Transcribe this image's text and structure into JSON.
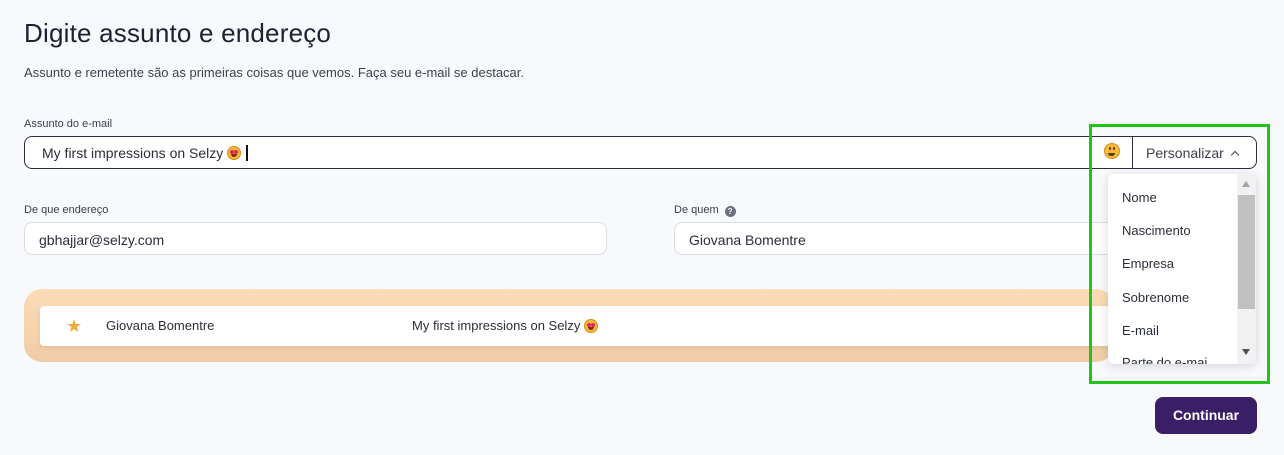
{
  "page": {
    "title": "Digite assunto e endereço",
    "subtitle": "Assunto e remetente são as primeiras coisas que vemos. Faça seu e-mail se destacar."
  },
  "subject": {
    "label": "Assunto do e-mail",
    "value": "My first impressions on Selzy",
    "personalize_label": "Personalizar",
    "emoji_icon": "smiley-icon"
  },
  "from_address": {
    "label": "De que endereço",
    "value": "gbhajjar@selzy.com"
  },
  "from_name": {
    "label": "De quem",
    "value": "Giovana Bomentre",
    "help_icon": "question-icon"
  },
  "preview": {
    "sender": "Giovana Bomentre",
    "subject": "My first impressions on Selzy",
    "star_icon": "star-icon",
    "star_color": "#f2a93b"
  },
  "personalize_menu": {
    "items": [
      "Nome",
      "Nascimento",
      "Empresa",
      "Sobrenome",
      "E-mail",
      "Parte do e-mai"
    ]
  },
  "actions": {
    "continue_label": "Continuar"
  },
  "colors": {
    "primary": "#3b1f66",
    "highlight": "#22c31c",
    "preview_bg": "#fbdcb6"
  }
}
